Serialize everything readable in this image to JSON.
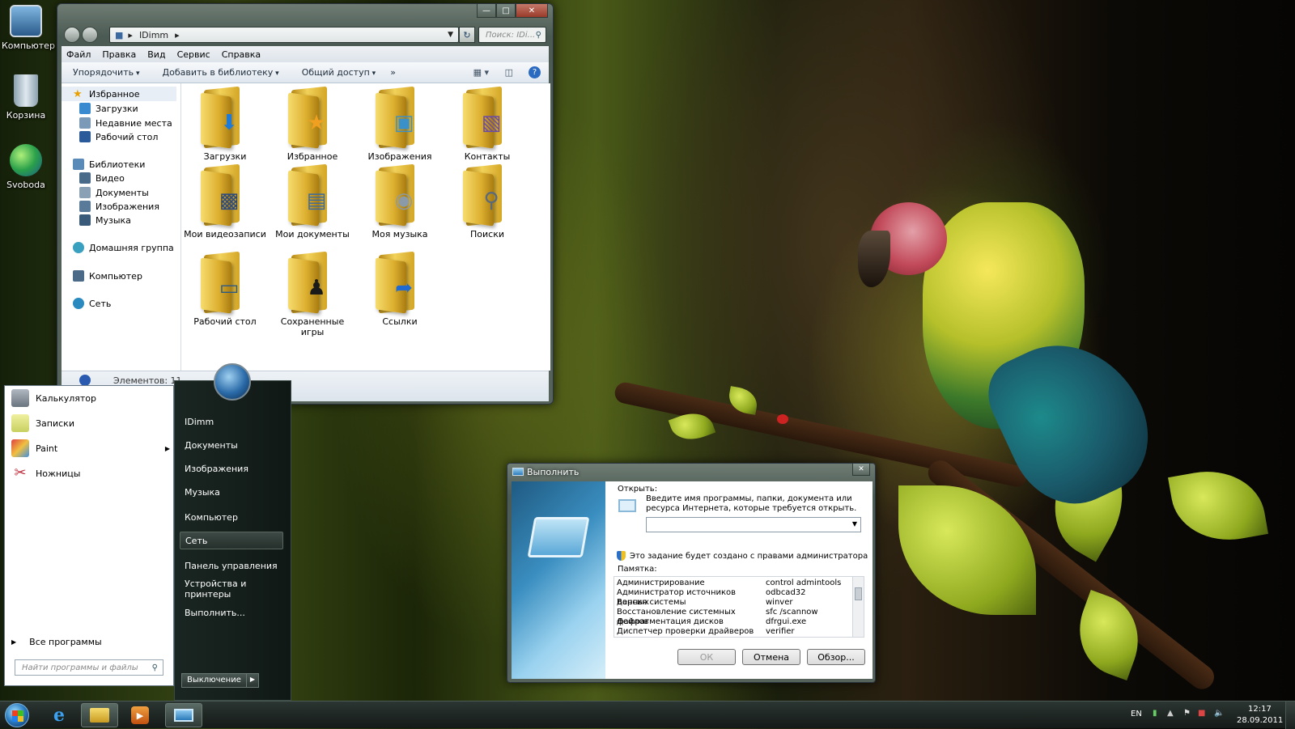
{
  "desktop": {
    "icons": [
      {
        "label": "Компьютер",
        "icon": "computer-icon"
      },
      {
        "label": "Корзина",
        "icon": "recycle-bin-icon"
      },
      {
        "label": "Svoboda",
        "icon": "globe-icon"
      }
    ]
  },
  "explorer": {
    "breadcrumb": "IDimm",
    "search_placeholder": "Поиск: IDi...",
    "menu": [
      "Файл",
      "Правка",
      "Вид",
      "Сервис",
      "Справка"
    ],
    "commands": [
      "Упорядочить",
      "Добавить в библиотеку",
      "Общий доступ"
    ],
    "commands_more": "»",
    "nav": {
      "favorites": "Избранное",
      "favorites_items": [
        "Загрузки",
        "Недавние места",
        "Рабочий стол"
      ],
      "libraries": "Библиотеки",
      "libraries_items": [
        "Видео",
        "Документы",
        "Изображения",
        "Музыка"
      ],
      "homegroup": "Домашняя группа",
      "computer": "Компьютер",
      "network": "Сеть"
    },
    "folders": [
      {
        "label": "Загрузки",
        "emblem": "download-arrow-icon"
      },
      {
        "label": "Избранное",
        "emblem": "star-icon"
      },
      {
        "label": "Изображения",
        "emblem": "picture-icon"
      },
      {
        "label": "Контакты",
        "emblem": "contact-card-icon"
      },
      {
        "label": "Мои видеозаписи",
        "emblem": "film-icon"
      },
      {
        "label": "Мои документы",
        "emblem": "document-icon"
      },
      {
        "label": "Моя музыка",
        "emblem": "music-disc-icon"
      },
      {
        "label": "Поиски",
        "emblem": "magnifier-icon"
      },
      {
        "label": "Рабочий стол",
        "emblem": "desktop-icon"
      },
      {
        "label": "Сохраненные игры",
        "emblem": "chess-piece-icon"
      },
      {
        "label": "Ссылки",
        "emblem": "link-arrow-icon"
      }
    ],
    "status": "Элементов: 11"
  },
  "start_menu": {
    "programs": [
      {
        "label": "Калькулятор",
        "icon": "calculator-icon"
      },
      {
        "label": "Записки",
        "icon": "sticky-notes-icon"
      },
      {
        "label": "Paint",
        "icon": "paint-icon"
      },
      {
        "label": "Ножницы",
        "icon": "scissors-icon"
      }
    ],
    "all_programs": "Все программы",
    "search_placeholder": "Найти программы и файлы",
    "right_items": [
      "IDimm",
      "Документы",
      "Изображения",
      "Музыка",
      "Компьютер",
      "Сеть",
      "Панель управления",
      "Устройства и принтеры",
      "Выполнить..."
    ],
    "shutdown": "Выключение"
  },
  "run_dialog": {
    "title": "Выполнить",
    "open_label": "Открыть:",
    "description": "Введите имя программы, папки, документа или ресурса Интернета, которые требуется открыть.",
    "admin_note": "Это задание будет создано с правами администратора",
    "memo_label": "Памятка:",
    "memo": [
      [
        "Администрирование",
        "control admintools"
      ],
      [
        "Администратор источников данных",
        "odbcad32"
      ],
      [
        "Версия системы",
        "winver"
      ],
      [
        "Восстановление системных файлов",
        "sfc /scannow"
      ],
      [
        "Дефрагментация дисков",
        "dfrgui.exe"
      ],
      [
        "Диспетчер проверки драйверов",
        "verifier"
      ]
    ],
    "ok": "ОК",
    "cancel": "Отмена",
    "browse": "Обзор..."
  },
  "taskbar": {
    "language": "EN",
    "time": "12:17",
    "date": "28.09.2011"
  }
}
